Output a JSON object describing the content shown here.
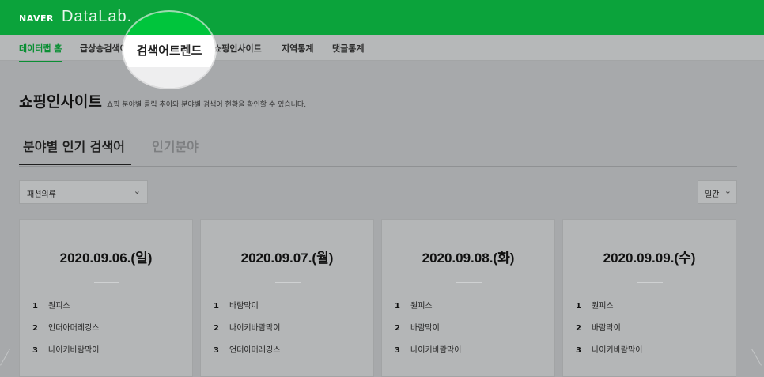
{
  "header": {
    "brand": "NAVER",
    "product": "DataLab."
  },
  "nav": {
    "items": [
      "데이터랩 홈",
      "급상승검색어",
      "쇼핑인사이트",
      "지역통계",
      "댓글통계"
    ],
    "highlight": "검색어트렌드"
  },
  "page": {
    "title": "쇼핑인사이트",
    "description": "쇼핑 분야별 클릭 추이와 분야별 검색어 현황을 확인할 수 있습니다."
  },
  "tabs": [
    "분야별 인기 검색어",
    "인기분야"
  ],
  "filters": {
    "category": "패션의류",
    "period": "일간"
  },
  "icons": {
    "chevron": "chevron-down-icon"
  },
  "cards": [
    {
      "date": "2020.09.06.(일)",
      "items": [
        {
          "rank": "1",
          "name": "원피스"
        },
        {
          "rank": "2",
          "name": "언더아머레깅스"
        },
        {
          "rank": "3",
          "name": "나이키바람막이"
        }
      ]
    },
    {
      "date": "2020.09.07.(월)",
      "items": [
        {
          "rank": "1",
          "name": "바람막이"
        },
        {
          "rank": "2",
          "name": "나이키바람막이"
        },
        {
          "rank": "3",
          "name": "언더아머레깅스"
        }
      ]
    },
    {
      "date": "2020.09.08.(화)",
      "items": [
        {
          "rank": "1",
          "name": "원피스"
        },
        {
          "rank": "2",
          "name": "바람막이"
        },
        {
          "rank": "3",
          "name": "나이키바람막이"
        }
      ]
    },
    {
      "date": "2020.09.09.(수)",
      "items": [
        {
          "rank": "1",
          "name": "원피스"
        },
        {
          "rank": "2",
          "name": "바람막이"
        },
        {
          "rank": "3",
          "name": "나이키바람막이"
        }
      ]
    }
  ]
}
